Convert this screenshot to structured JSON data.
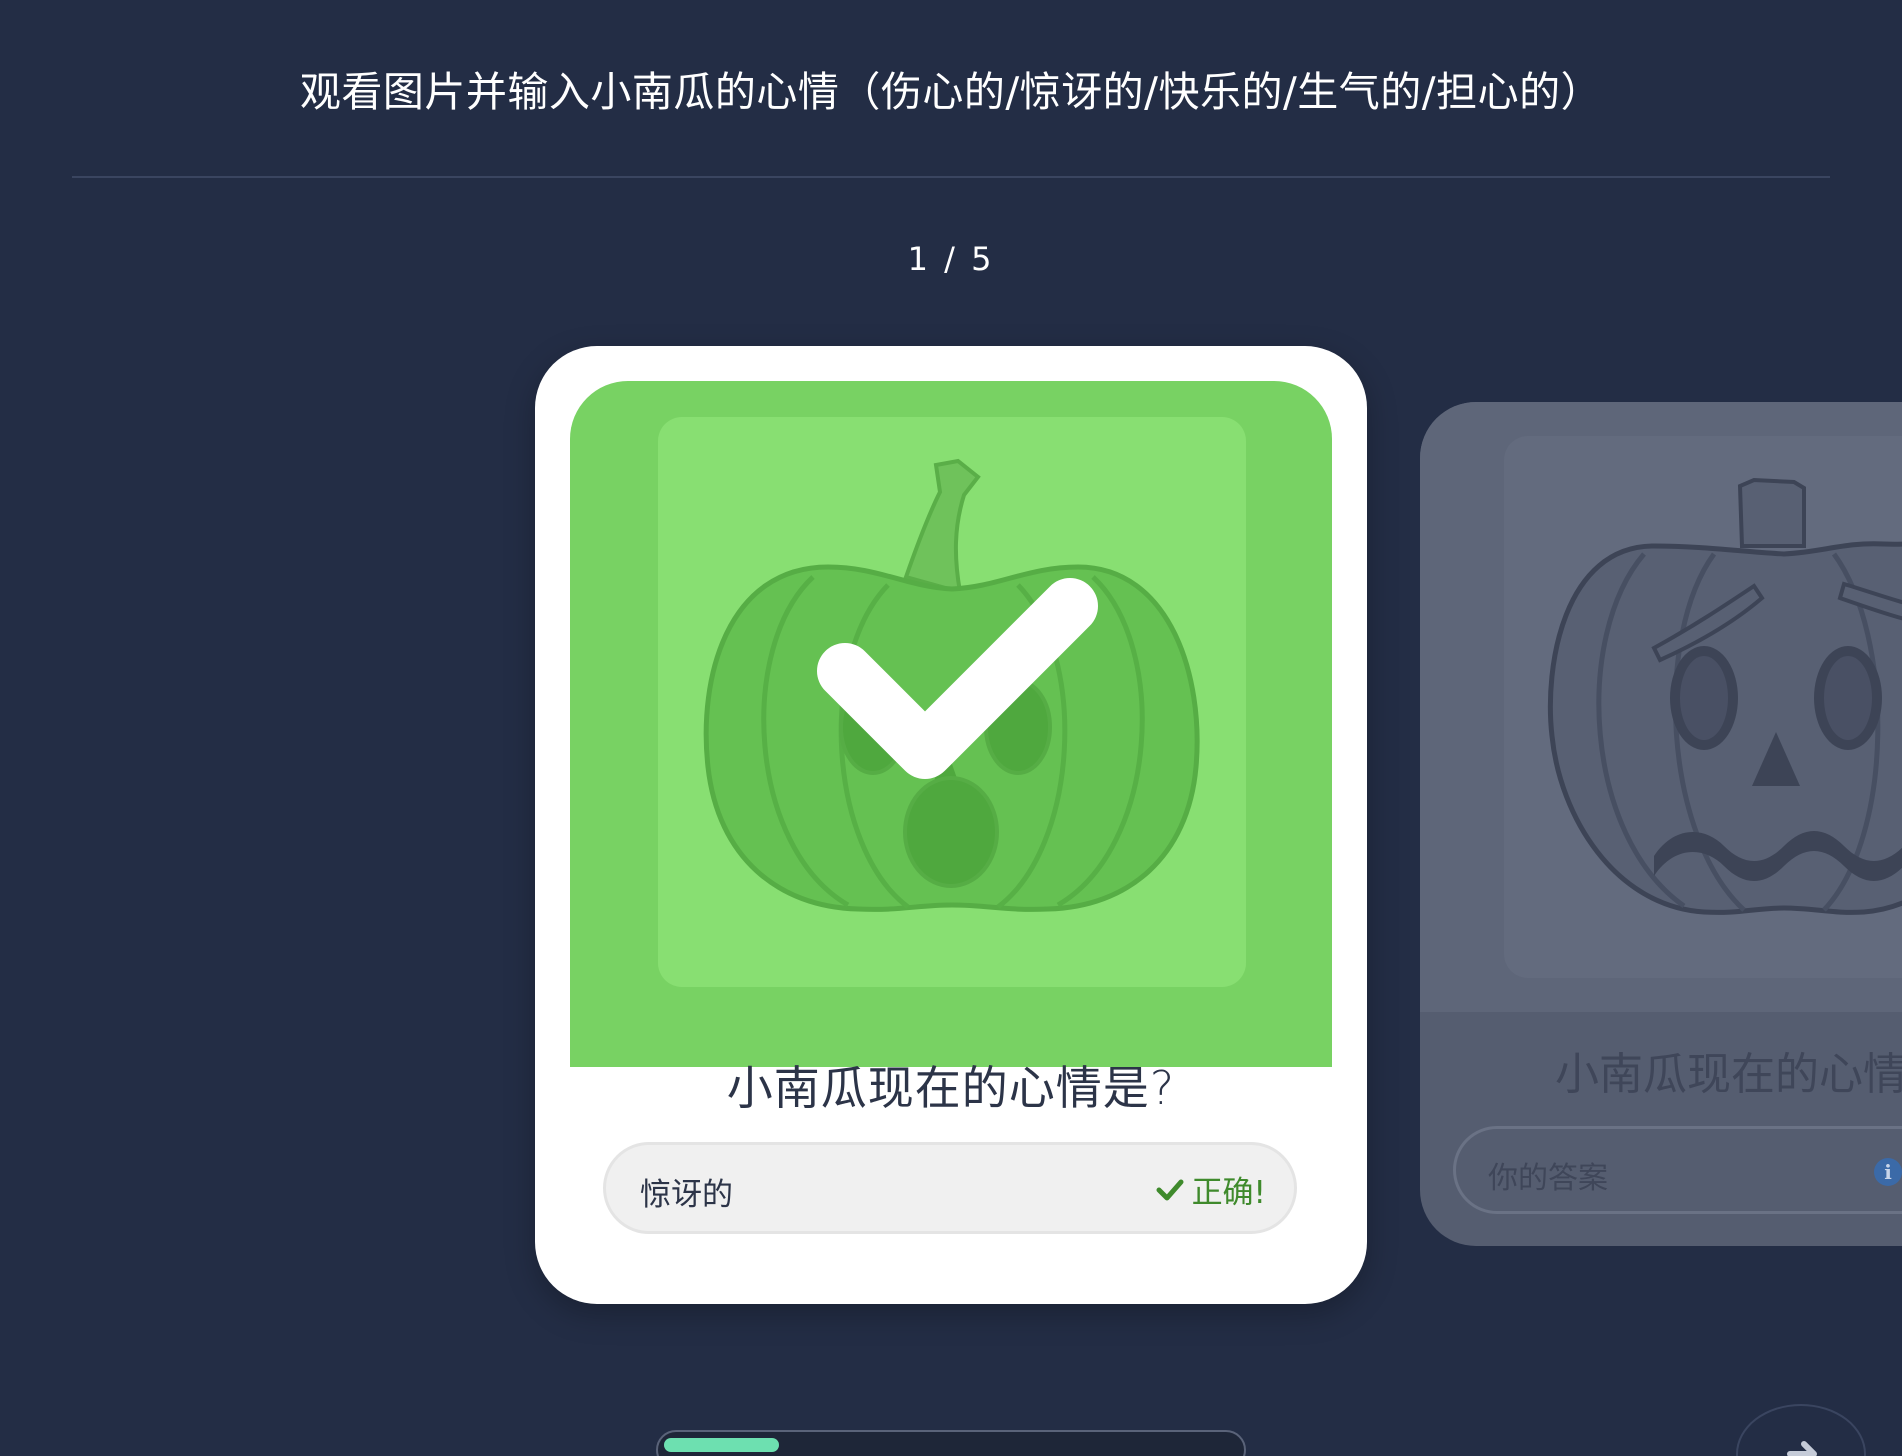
{
  "header": {
    "title": "观看图片并输入小南瓜的心情（伤心的/惊讶的/快乐的/生气的/担心的）"
  },
  "pagination": {
    "counter": "1 / 5"
  },
  "cards": [
    {
      "image_icon": "surprised-pumpkin",
      "overlay_icon": "check-icon",
      "question": "小南瓜现在的心情是?",
      "answer": "惊讶的",
      "status": "正确!",
      "status_color": "#3f8a2c"
    },
    {
      "image_icon": "worried-pumpkin",
      "question": "小南瓜现在的心情",
      "answer_placeholder": "你的答案",
      "hint_icon": "info-icon"
    }
  ],
  "progress": {
    "fraction": 0.2
  },
  "colors": {
    "background": "#232d45",
    "correct_green": "#78d263",
    "progress_accent": "#6de0b0"
  },
  "navigation": {
    "next_icon": "arrow-right-icon"
  }
}
